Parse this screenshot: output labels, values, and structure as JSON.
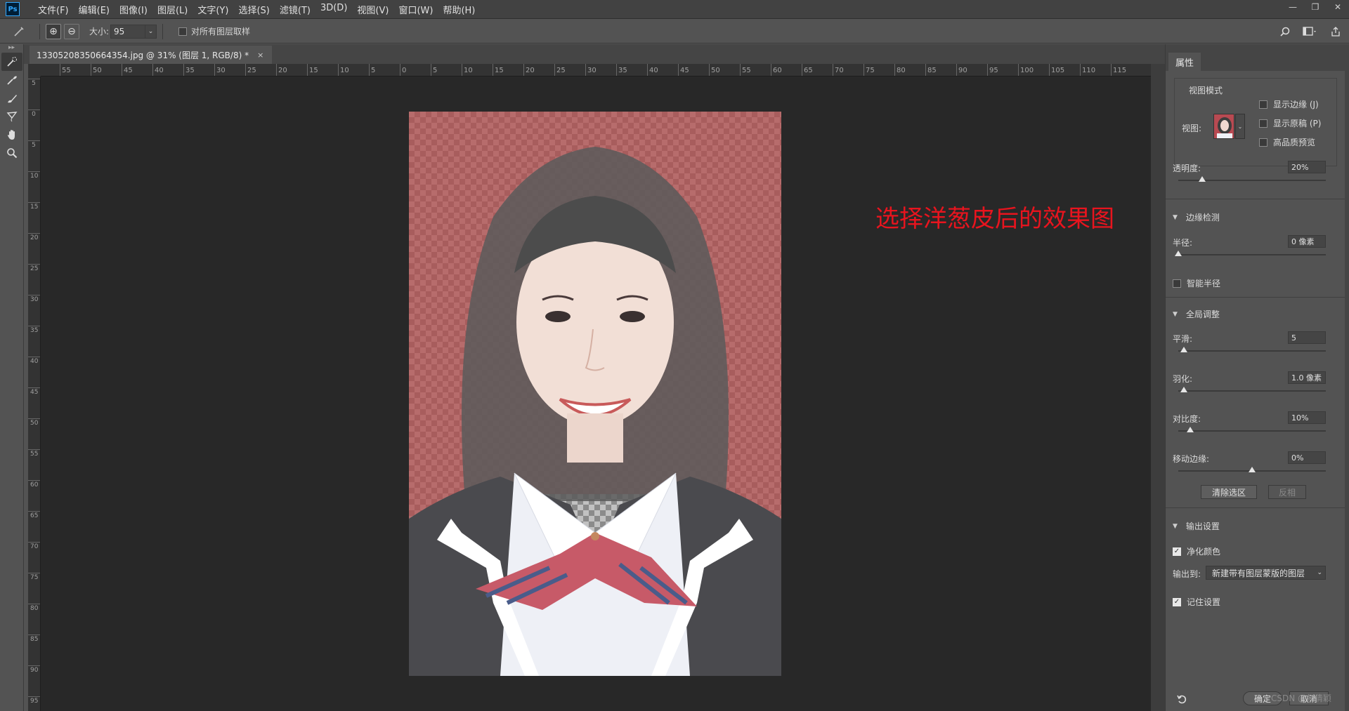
{
  "app": {
    "logo_text": "Ps"
  },
  "menu": [
    "文件(F)",
    "编辑(E)",
    "图像(I)",
    "图层(L)",
    "文字(Y)",
    "选择(S)",
    "滤镜(T)",
    "3D(D)",
    "视图(V)",
    "窗口(W)",
    "帮助(H)"
  ],
  "window_controls": {
    "minimize": "—",
    "restore": "❐",
    "close": "✕"
  },
  "options_bar": {
    "size_label": "大小:",
    "size_value": "95",
    "sample_all_layers": "对所有图层取样",
    "sample_all_checked": false
  },
  "document": {
    "tab_title": "13305208350664354.jpg @ 31% (图层 1, RGB/8) *",
    "close_glyph": "×",
    "annotation": "选择洋葱皮后的效果图"
  },
  "rulers": {
    "horizontal": [
      "55",
      "50",
      "45",
      "40",
      "35",
      "30",
      "25",
      "20",
      "15",
      "10",
      "5",
      "0",
      "5",
      "10",
      "15",
      "20",
      "25",
      "30",
      "35",
      "40",
      "45",
      "50",
      "55",
      "60",
      "65",
      "70",
      "75",
      "80",
      "85",
      "90",
      "95",
      "100",
      "105",
      "110",
      "115"
    ],
    "vertical": [
      "5",
      "0",
      "5",
      "10",
      "15",
      "20",
      "25",
      "30",
      "35",
      "40",
      "45",
      "50",
      "55",
      "60",
      "65",
      "70",
      "75",
      "80",
      "85",
      "90",
      "95"
    ]
  },
  "properties": {
    "tab": "属性",
    "view_mode": {
      "title": "视图模式",
      "view_label": "视图:",
      "show_edge": "显示边缘 (J)",
      "show_original": "显示原稿 (P)",
      "hq_preview": "高品质预览"
    },
    "opacity": {
      "label": "透明度:",
      "value": "20%",
      "fraction": 0.16
    },
    "edge_detection": {
      "title": "边缘检测",
      "radius_label": "半径:",
      "radius_value": "0 像素",
      "radius_fraction": 0.0,
      "smart_radius": "智能半径"
    },
    "global_refine": {
      "title": "全局调整",
      "smooth_label": "平滑:",
      "smooth_value": "5",
      "smooth_fraction": 0.04,
      "feather_label": "羽化:",
      "feather_value": "1.0 像素",
      "feather_fraction": 0.04,
      "contrast_label": "对比度:",
      "contrast_value": "10%",
      "contrast_fraction": 0.08,
      "shift_edge_label": "移动边缘:",
      "shift_edge_value": "0%",
      "shift_edge_fraction": 0.5,
      "clear_selection": "清除选区",
      "invert": "反相"
    },
    "output": {
      "title": "输出设置",
      "decontaminate": "净化颜色",
      "output_to_label": "输出到:",
      "output_to_value": "新建带有图层蒙版的图层",
      "remember": "记住设置"
    },
    "footer": {
      "ok": "确定",
      "cancel": "取消",
      "watermark": "CSDN @刘倩颖"
    }
  }
}
